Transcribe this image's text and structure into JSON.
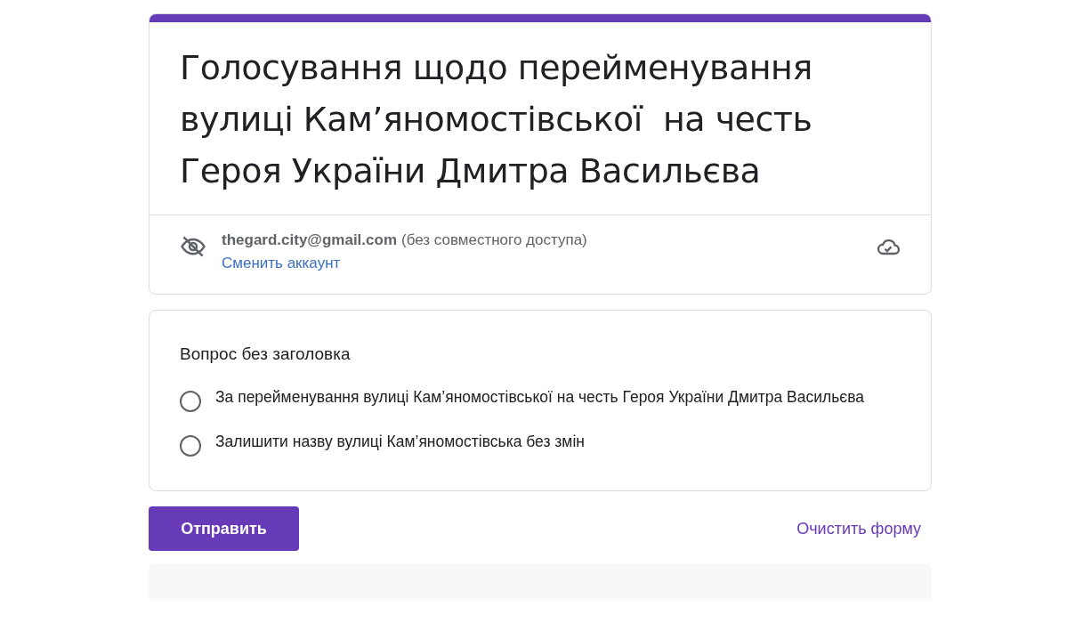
{
  "form": {
    "title": "Голосування щодо перейменування вулиці Кам’яномостівської  на честь Героя України Дмитра Васильєва"
  },
  "account": {
    "email": "thegard.city@gmail.com",
    "note": "(без совместного доступа)",
    "switch_link": "Сменить аккаунт"
  },
  "question": {
    "title": "Вопрос без заголовка",
    "options": [
      {
        "label": "За перейменування вулиці Кам’яномостівської на честь Героя України Дмитра Васильєва",
        "selected": false
      },
      {
        "label": "Залишити назву вулиці Кам’яномостівська без змін",
        "selected": false
      }
    ]
  },
  "actions": {
    "submit": "Отправить",
    "clear": "Очистить форму"
  }
}
